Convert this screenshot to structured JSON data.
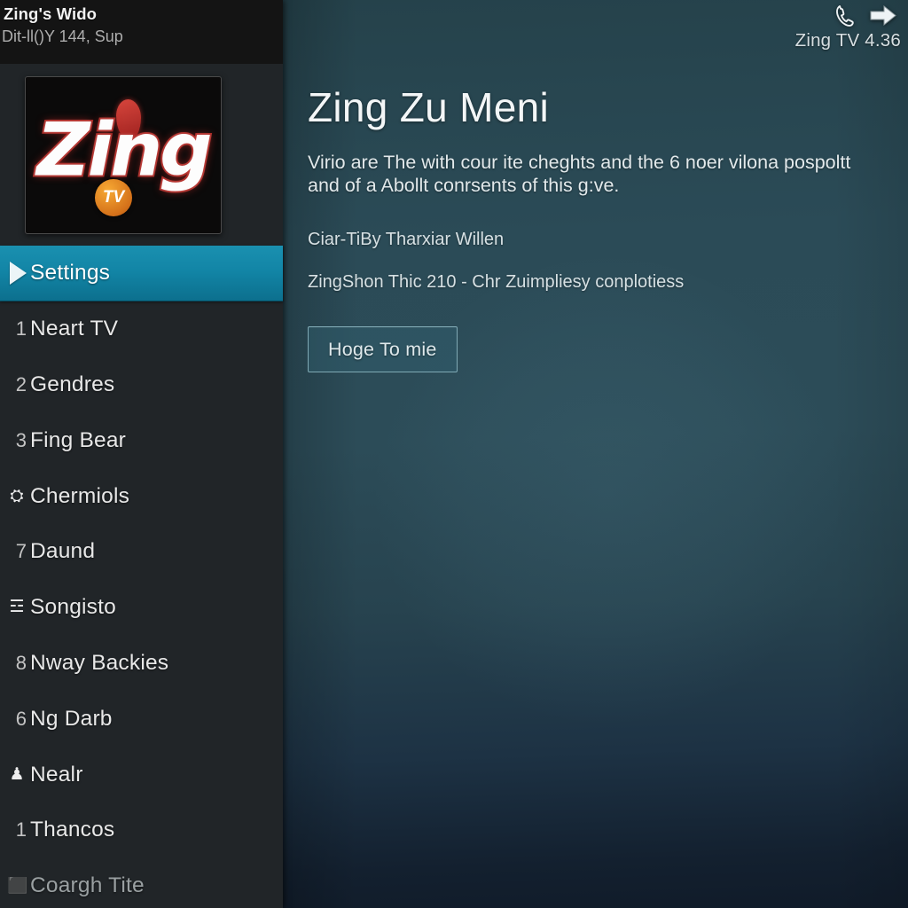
{
  "window": {
    "title": "Zing's Wido",
    "subtitle": "Dit-ll()Y  144, Sup"
  },
  "logo": {
    "word": "Zing",
    "badge": "TV"
  },
  "topbar": {
    "phone_icon": "phone-handset-icon",
    "arrow_icon": "right-arrow-icon",
    "version": "Zing TV 4.36"
  },
  "menu": {
    "items": [
      {
        "gutter": "▶",
        "gutter_type": "cursor",
        "label": "Settings",
        "active": true,
        "dim": false
      },
      {
        "gutter": "1",
        "gutter_type": "number",
        "label": "Neart TV",
        "active": false,
        "dim": false
      },
      {
        "gutter": "2",
        "gutter_type": "number",
        "label": "Gendres",
        "active": false,
        "dim": false
      },
      {
        "gutter": "3",
        "gutter_type": "number",
        "label": "Fing Bear",
        "active": false,
        "dim": false
      },
      {
        "gutter": "⛭",
        "gutter_type": "icon",
        "label": "Chermiols",
        "active": false,
        "dim": false
      },
      {
        "gutter": "7",
        "gutter_type": "number",
        "label": "Daund",
        "active": false,
        "dim": false
      },
      {
        "gutter": "☲",
        "gutter_type": "icon",
        "label": "Songisto",
        "active": false,
        "dim": false
      },
      {
        "gutter": "8",
        "gutter_type": "number",
        "label": "Nway Backies",
        "active": false,
        "dim": false
      },
      {
        "gutter": "6",
        "gutter_type": "number",
        "label": "Ng Darb",
        "active": false,
        "dim": false
      },
      {
        "gutter": "♟",
        "gutter_type": "icon",
        "label": "Nealr",
        "active": false,
        "dim": false
      },
      {
        "gutter": "1",
        "gutter_type": "number",
        "label": "Thancos",
        "active": false,
        "dim": false
      },
      {
        "gutter": "⬛",
        "gutter_type": "icon",
        "label": "Coargh Tite",
        "active": false,
        "dim": true
      }
    ]
  },
  "main": {
    "title": "Zing Zu Meni",
    "description": "Virio are The with cour ite cheghts and the 6 noer vilona pospoltt and of a Abollt conrsents of this g:ve.",
    "meta_line_1": "Ciar-TiBy Tharxiar Willen",
    "meta_line_2": "ZingShon Thic 210 - Chr Zuimpliesy conplotiess",
    "button_label": "Hoge To mie"
  },
  "colors": {
    "accent": "#1285a6",
    "sidebar_bg": "#212528",
    "main_bg_top": "#2b4b57",
    "main_bg_bottom": "#101b29",
    "logo_red": "#a92c28",
    "logo_badge": "#d4711a"
  }
}
